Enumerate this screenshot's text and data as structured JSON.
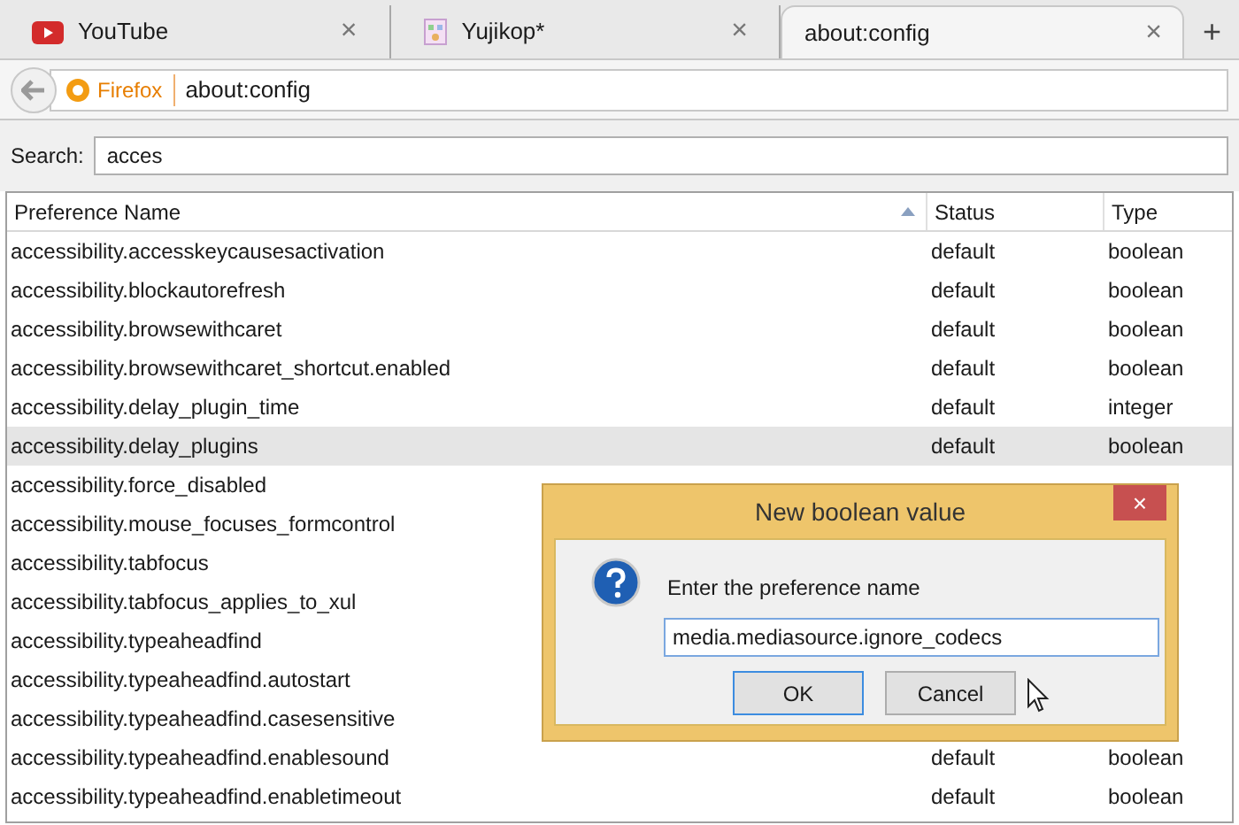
{
  "tabs": [
    {
      "title": "YouTube",
      "kind": "video",
      "selected": false
    },
    {
      "title": "Yujikop*",
      "kind": "page",
      "selected": false
    },
    {
      "title": "about:config",
      "kind": "plain",
      "selected": true
    }
  ],
  "new_tab": "+",
  "close_tab": "×",
  "url_bar": {
    "identity": "Firefox",
    "url": "about:config"
  },
  "search": {
    "label": "Search:",
    "value": "acces"
  },
  "table": {
    "columns": [
      "Preference Name",
      "Status",
      "Type"
    ],
    "rows": [
      {
        "name": "accessibility.accesskeycausesactivation",
        "status": "default",
        "type": "boolean",
        "selected": false
      },
      {
        "name": "accessibility.blockautorefresh",
        "status": "default",
        "type": "boolean",
        "selected": false
      },
      {
        "name": "accessibility.browsewithcaret",
        "status": "default",
        "type": "boolean",
        "selected": false
      },
      {
        "name": "accessibility.browsewithcaret_shortcut.enabled",
        "status": "default",
        "type": "boolean",
        "selected": false
      },
      {
        "name": "accessibility.delay_plugin_time",
        "status": "default",
        "type": "integer",
        "selected": false
      },
      {
        "name": "accessibility.delay_plugins",
        "status": "default",
        "type": "boolean",
        "selected": true
      },
      {
        "name": "accessibility.force_disabled",
        "selected": false
      },
      {
        "name": "accessibility.mouse_focuses_formcontrol",
        "selected": false
      },
      {
        "name": "accessibility.tabfocus",
        "selected": false
      },
      {
        "name": "accessibility.tabfocus_applies_to_xul",
        "selected": false
      },
      {
        "name": "accessibility.typeaheadfind",
        "selected": false
      },
      {
        "name": "accessibility.typeaheadfind.autostart",
        "selected": false
      },
      {
        "name": "accessibility.typeaheadfind.casesensitive",
        "selected": false
      },
      {
        "name": "accessibility.typeaheadfind.enablesound",
        "status": "default",
        "type": "boolean",
        "selected": false
      },
      {
        "name": "accessibility.typeaheadfind.enabletimeout",
        "status": "default",
        "type": "boolean",
        "selected": false
      }
    ]
  },
  "dialog": {
    "title": "New boolean value",
    "close": "×",
    "prompt": "Enter the preference name",
    "value": "media.mediasource.ignore_codecs",
    "buttons": [
      {
        "label": "OK",
        "selected": true
      },
      {
        "label": "Cancel",
        "selected": false
      }
    ]
  }
}
